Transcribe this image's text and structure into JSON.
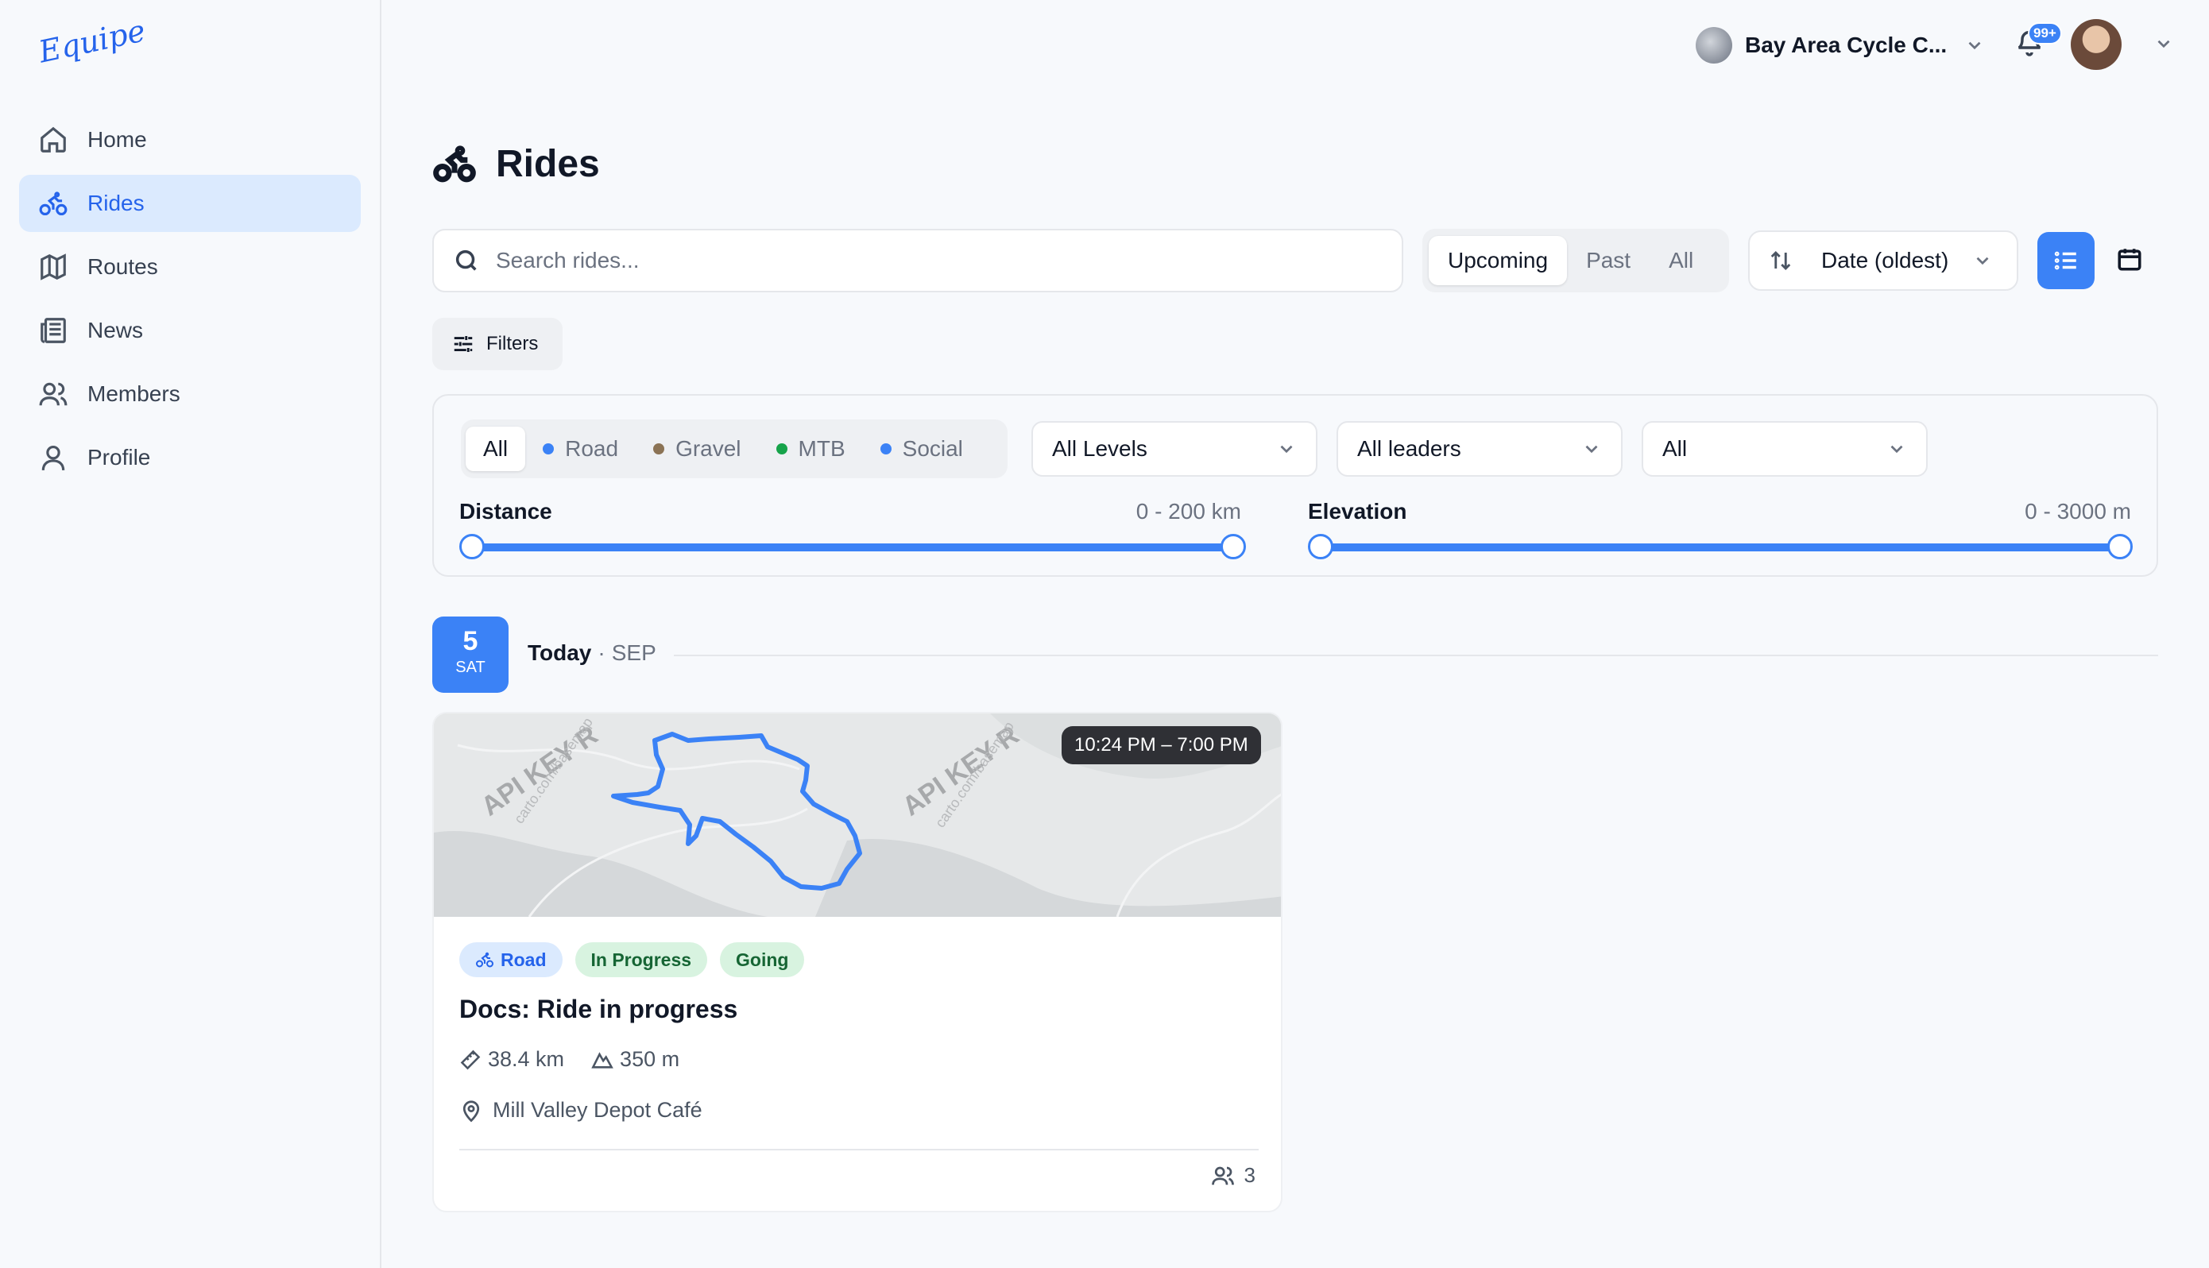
{
  "app": {
    "logo_text": "Equipe"
  },
  "sidebar": {
    "items": [
      {
        "label": "Home",
        "icon": "home-icon",
        "active": false
      },
      {
        "label": "Rides",
        "icon": "bike-icon",
        "active": true
      },
      {
        "label": "Routes",
        "icon": "map-icon",
        "active": false
      },
      {
        "label": "News",
        "icon": "newspaper-icon",
        "active": false
      },
      {
        "label": "Members",
        "icon": "users-icon",
        "active": false
      },
      {
        "label": "Profile",
        "icon": "user-icon",
        "active": false
      }
    ]
  },
  "topbar": {
    "club_name": "Bay Area Cycle C...",
    "notifications_badge": "99+"
  },
  "page": {
    "title": "Rides"
  },
  "search": {
    "placeholder": "Search rides..."
  },
  "time_filter": {
    "options": [
      "Upcoming",
      "Past",
      "All"
    ],
    "selected": "Upcoming"
  },
  "sort": {
    "label": "Date (oldest)"
  },
  "filters_button": {
    "label": "Filters"
  },
  "filter_panel": {
    "types": [
      {
        "label": "All",
        "dot_color": null
      },
      {
        "label": "Road",
        "dot_color": "#3b82f6"
      },
      {
        "label": "Gravel",
        "dot_color": "#8b7355"
      },
      {
        "label": "MTB",
        "dot_color": "#16a34a"
      },
      {
        "label": "Social",
        "dot_color": "#3b82f6"
      }
    ],
    "selected_type": "All",
    "level_select": "All Levels",
    "leader_select": "All leaders",
    "third_select": "All",
    "distance": {
      "label": "Distance",
      "value_text": "0 - 200 km",
      "min": 0,
      "max": 200
    },
    "elevation": {
      "label": "Elevation",
      "value_text": "0 - 3000 m",
      "min": 0,
      "max": 3000
    }
  },
  "date_group": {
    "day_number": "5",
    "day_of_week": "SAT",
    "label": "Today",
    "separator": "·",
    "month": "SEP"
  },
  "ride_card": {
    "time_range": "10:24 PM – 7:00 PM",
    "map_watermark": "API KEY R",
    "map_attribution": "carto.com/basemap",
    "tags": {
      "type": "Road",
      "status": "In Progress",
      "rsvp": "Going"
    },
    "title": "Docs: Ride in progress",
    "distance": "38.4 km",
    "elevation": "350 m",
    "location": "Mill Valley Depot Café",
    "attendees": "3"
  },
  "colors": {
    "accent": "#3b82f6",
    "active_nav_bg": "#dbeafe",
    "route_line": "#3b82f6"
  }
}
